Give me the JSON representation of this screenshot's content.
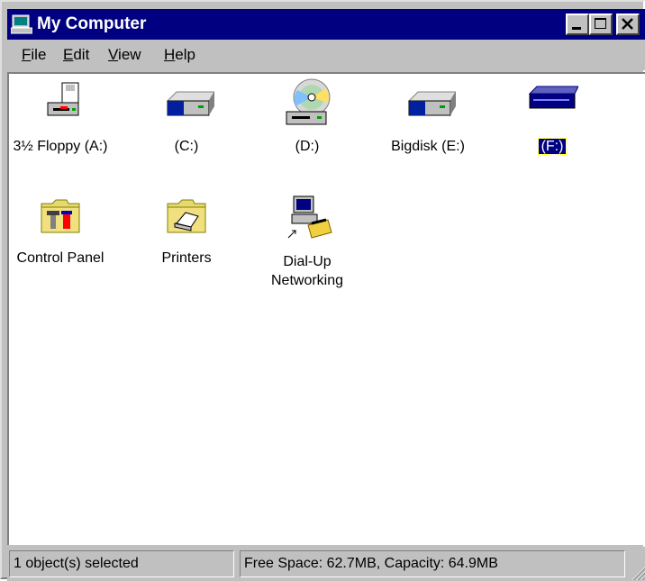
{
  "window": {
    "title": "My Computer",
    "title_icon": "computer-icon"
  },
  "titlebar_buttons": [
    "minimize-icon",
    "maximize-icon",
    "close-icon"
  ],
  "menu": [
    {
      "label": "File",
      "accel": "F",
      "rest": "ile"
    },
    {
      "label": "Edit",
      "accel": "E",
      "rest": "dit"
    },
    {
      "label": "View",
      "accel": "V",
      "rest": "iew"
    },
    {
      "label": "Help",
      "accel": "H",
      "rest": "elp"
    }
  ],
  "items": [
    {
      "label": "3½ Floppy (A:)",
      "icon": "floppy-drive-icon",
      "selected": false
    },
    {
      "label": "(C:)",
      "icon": "hard-drive-icon",
      "selected": false
    },
    {
      "label": "(D:)",
      "icon": "cd-drive-icon",
      "selected": false
    },
    {
      "label": "Bigdisk (E:)",
      "icon": "hard-drive-icon",
      "selected": false
    },
    {
      "label": "(F:)",
      "icon": "removable-drive-icon",
      "selected": true
    },
    {
      "label": "Control Panel",
      "icon": "control-panel-folder-icon",
      "selected": false
    },
    {
      "label": "Printers",
      "icon": "printers-folder-icon",
      "selected": false
    },
    {
      "label": "Dial-Up",
      "label2": "Networking",
      "icon": "dialup-networking-icon",
      "selected": false
    }
  ],
  "status": {
    "left": "1 object(s) selected",
    "right": "Free Space: 62.7MB,  Capacity: 64.9MB"
  },
  "colors": {
    "titlebar": "#000080",
    "face": "#c0c0c0",
    "selection": "#000080"
  }
}
